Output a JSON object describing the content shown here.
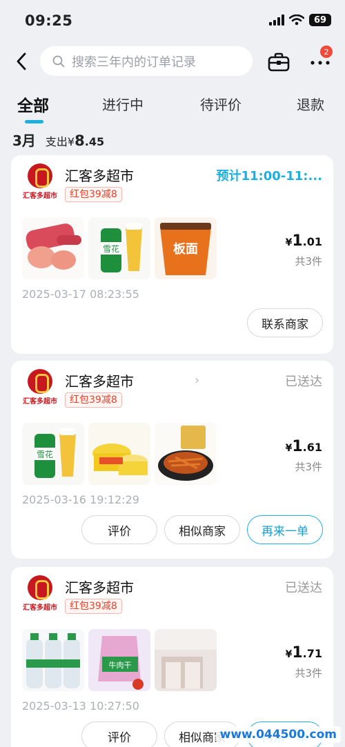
{
  "status_bar": {
    "time": "09:25",
    "battery": "69"
  },
  "header": {
    "search_placeholder": "搜索三年内的订单记录",
    "more_badge": "2"
  },
  "tabs": [
    {
      "label": "全部",
      "active": true
    },
    {
      "label": "进行中",
      "active": false
    },
    {
      "label": "待评价",
      "active": false
    },
    {
      "label": "退款",
      "active": false
    }
  ],
  "summary": {
    "month": "3月",
    "spend_prefix": "支出¥",
    "spend_int": "8",
    "spend_dec": ".45"
  },
  "orders": [
    {
      "logo_text": "汇客多超市",
      "shop_name": "汇客多超市",
      "redpack": "红包39减8",
      "status": "预计11:00-11:...",
      "items": [
        "sausage",
        "snow-beer",
        "banmian-noodle-cup"
      ],
      "price_int": "1",
      "price_dec": ".01",
      "qty": "共3件",
      "time": "2025-03-17 08:23:55",
      "buttons": [
        "联系商家"
      ]
    },
    {
      "logo_text": "汇客多超市",
      "shop_name": "汇客多超市",
      "redpack": "红包39减8",
      "status": "已送达",
      "items": [
        "snow-beer",
        "noodle-bowl",
        "spicy-strips"
      ],
      "price_int": "1",
      "price_dec": ".61",
      "qty": "共3件",
      "time": "2025-03-16 19:12:29",
      "buttons": [
        "评价",
        "相似商家",
        "再来一单"
      ]
    },
    {
      "logo_text": "汇客多超市",
      "shop_name": "汇客多超市",
      "redpack": "红包39减8",
      "status": "已送达",
      "items": [
        "water-bottles",
        "beef-jerky",
        "room-photo"
      ],
      "price_int": "1",
      "price_dec": ".71",
      "qty": "共3件",
      "time": "2025-03-13 10:27:50",
      "buttons": [
        "评价",
        "相似商家",
        "再来一单"
      ]
    }
  ],
  "watermark": "www.044500.com",
  "colors": {
    "accent": "#1cb0e0",
    "brand_red": "#c8181f",
    "badge_red": "#f04a3a"
  }
}
